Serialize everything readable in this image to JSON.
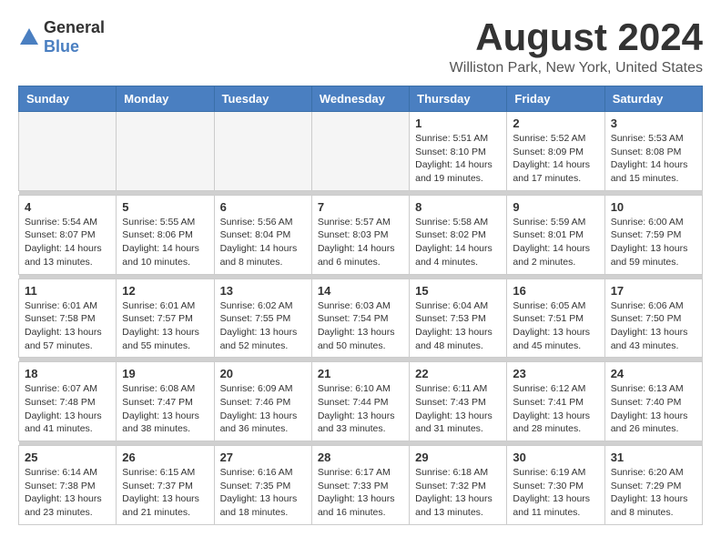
{
  "header": {
    "logo_general": "General",
    "logo_blue": "Blue",
    "month_title": "August 2024",
    "location": "Williston Park, New York, United States"
  },
  "days_of_week": [
    "Sunday",
    "Monday",
    "Tuesday",
    "Wednesday",
    "Thursday",
    "Friday",
    "Saturday"
  ],
  "weeks": [
    [
      {
        "day": "",
        "info": ""
      },
      {
        "day": "",
        "info": ""
      },
      {
        "day": "",
        "info": ""
      },
      {
        "day": "",
        "info": ""
      },
      {
        "day": "1",
        "info": "Sunrise: 5:51 AM\nSunset: 8:10 PM\nDaylight: 14 hours\nand 19 minutes."
      },
      {
        "day": "2",
        "info": "Sunrise: 5:52 AM\nSunset: 8:09 PM\nDaylight: 14 hours\nand 17 minutes."
      },
      {
        "day": "3",
        "info": "Sunrise: 5:53 AM\nSunset: 8:08 PM\nDaylight: 14 hours\nand 15 minutes."
      }
    ],
    [
      {
        "day": "4",
        "info": "Sunrise: 5:54 AM\nSunset: 8:07 PM\nDaylight: 14 hours\nand 13 minutes."
      },
      {
        "day": "5",
        "info": "Sunrise: 5:55 AM\nSunset: 8:06 PM\nDaylight: 14 hours\nand 10 minutes."
      },
      {
        "day": "6",
        "info": "Sunrise: 5:56 AM\nSunset: 8:04 PM\nDaylight: 14 hours\nand 8 minutes."
      },
      {
        "day": "7",
        "info": "Sunrise: 5:57 AM\nSunset: 8:03 PM\nDaylight: 14 hours\nand 6 minutes."
      },
      {
        "day": "8",
        "info": "Sunrise: 5:58 AM\nSunset: 8:02 PM\nDaylight: 14 hours\nand 4 minutes."
      },
      {
        "day": "9",
        "info": "Sunrise: 5:59 AM\nSunset: 8:01 PM\nDaylight: 14 hours\nand 2 minutes."
      },
      {
        "day": "10",
        "info": "Sunrise: 6:00 AM\nSunset: 7:59 PM\nDaylight: 13 hours\nand 59 minutes."
      }
    ],
    [
      {
        "day": "11",
        "info": "Sunrise: 6:01 AM\nSunset: 7:58 PM\nDaylight: 13 hours\nand 57 minutes."
      },
      {
        "day": "12",
        "info": "Sunrise: 6:01 AM\nSunset: 7:57 PM\nDaylight: 13 hours\nand 55 minutes."
      },
      {
        "day": "13",
        "info": "Sunrise: 6:02 AM\nSunset: 7:55 PM\nDaylight: 13 hours\nand 52 minutes."
      },
      {
        "day": "14",
        "info": "Sunrise: 6:03 AM\nSunset: 7:54 PM\nDaylight: 13 hours\nand 50 minutes."
      },
      {
        "day": "15",
        "info": "Sunrise: 6:04 AM\nSunset: 7:53 PM\nDaylight: 13 hours\nand 48 minutes."
      },
      {
        "day": "16",
        "info": "Sunrise: 6:05 AM\nSunset: 7:51 PM\nDaylight: 13 hours\nand 45 minutes."
      },
      {
        "day": "17",
        "info": "Sunrise: 6:06 AM\nSunset: 7:50 PM\nDaylight: 13 hours\nand 43 minutes."
      }
    ],
    [
      {
        "day": "18",
        "info": "Sunrise: 6:07 AM\nSunset: 7:48 PM\nDaylight: 13 hours\nand 41 minutes."
      },
      {
        "day": "19",
        "info": "Sunrise: 6:08 AM\nSunset: 7:47 PM\nDaylight: 13 hours\nand 38 minutes."
      },
      {
        "day": "20",
        "info": "Sunrise: 6:09 AM\nSunset: 7:46 PM\nDaylight: 13 hours\nand 36 minutes."
      },
      {
        "day": "21",
        "info": "Sunrise: 6:10 AM\nSunset: 7:44 PM\nDaylight: 13 hours\nand 33 minutes."
      },
      {
        "day": "22",
        "info": "Sunrise: 6:11 AM\nSunset: 7:43 PM\nDaylight: 13 hours\nand 31 minutes."
      },
      {
        "day": "23",
        "info": "Sunrise: 6:12 AM\nSunset: 7:41 PM\nDaylight: 13 hours\nand 28 minutes."
      },
      {
        "day": "24",
        "info": "Sunrise: 6:13 AM\nSunset: 7:40 PM\nDaylight: 13 hours\nand 26 minutes."
      }
    ],
    [
      {
        "day": "25",
        "info": "Sunrise: 6:14 AM\nSunset: 7:38 PM\nDaylight: 13 hours\nand 23 minutes."
      },
      {
        "day": "26",
        "info": "Sunrise: 6:15 AM\nSunset: 7:37 PM\nDaylight: 13 hours\nand 21 minutes."
      },
      {
        "day": "27",
        "info": "Sunrise: 6:16 AM\nSunset: 7:35 PM\nDaylight: 13 hours\nand 18 minutes."
      },
      {
        "day": "28",
        "info": "Sunrise: 6:17 AM\nSunset: 7:33 PM\nDaylight: 13 hours\nand 16 minutes."
      },
      {
        "day": "29",
        "info": "Sunrise: 6:18 AM\nSunset: 7:32 PM\nDaylight: 13 hours\nand 13 minutes."
      },
      {
        "day": "30",
        "info": "Sunrise: 6:19 AM\nSunset: 7:30 PM\nDaylight: 13 hours\nand 11 minutes."
      },
      {
        "day": "31",
        "info": "Sunrise: 6:20 AM\nSunset: 7:29 PM\nDaylight: 13 hours\nand 8 minutes."
      }
    ]
  ]
}
